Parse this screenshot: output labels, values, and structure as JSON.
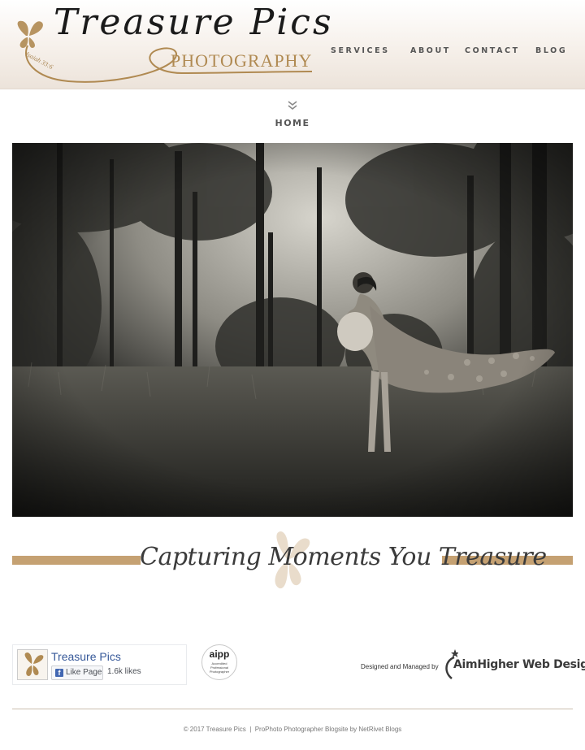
{
  "brand": {
    "logo_script": "Treasure Pics",
    "logo_subtitle": "PHOTOGRAPHY",
    "logo_verse": "Isaiah 33:6"
  },
  "nav": {
    "items": [
      {
        "label": "SERVICES"
      },
      {
        "label": "ABOUT"
      },
      {
        "label": "CONTACT"
      },
      {
        "label": "BLOG"
      }
    ]
  },
  "page": {
    "title": "HOME"
  },
  "tagline": "Capturing Moments You Treasure",
  "facebook": {
    "page_name": "Treasure Pics",
    "like_label": "Like Page",
    "likes": "1.6k likes"
  },
  "aipp": {
    "logo": "aipp",
    "text": "Accredited Professional Photographer"
  },
  "credit": {
    "designed_label": "Designed and Managed by",
    "company": "AimHigher Web Design"
  },
  "footer": {
    "copyright": "© 2017 Treasure Pics",
    "separator": "|",
    "prophoto": "ProPhoto Photographer Blogsite",
    "by_label": "by",
    "netrivet": "NetRivet Blogs"
  },
  "colors": {
    "accent_gold": "#c5a172",
    "logo_gold": "#b08a52",
    "nav_text": "#555555",
    "facebook_blue": "#365899"
  }
}
